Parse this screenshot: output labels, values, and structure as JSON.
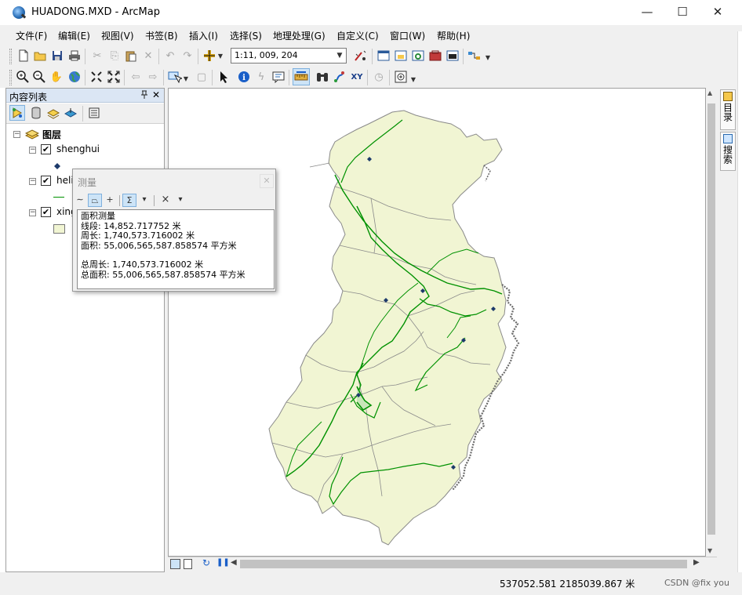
{
  "window": {
    "title": "HUADONG.MXD - ArcMap",
    "min": "—",
    "max": "☐",
    "close": "✕"
  },
  "menu": [
    "文件(F)",
    "编辑(E)",
    "视图(V)",
    "书签(B)",
    "插入(I)",
    "选择(S)",
    "地理处理(G)",
    "自定义(C)",
    "窗口(W)",
    "帮助(H)"
  ],
  "toolbar": {
    "scale": "1:11, 009, 204"
  },
  "toc": {
    "title": "内容列表",
    "pin": "𝟗",
    "close": "✕",
    "root": "图层",
    "layers": [
      {
        "name": "shenghui",
        "checked": "✔"
      },
      {
        "name": "heli",
        "checked": "✔"
      },
      {
        "name": "xing",
        "checked": "✔"
      }
    ]
  },
  "measure": {
    "title": "测量",
    "close": "✕",
    "tools": {
      "line": "∼",
      "area": "⏢",
      "feature": "+",
      "sum": "Σ",
      "units": "▾",
      "clear": "×",
      "clear_menu": "▾"
    },
    "heading": "面积测量",
    "segment": "线段: 14,852.717752 米",
    "perimeter": "周长: 1,740,573.716002 米",
    "area": "面积: 55,006,565,587.858574 平方米",
    "total_perimeter": "总周长: 1,740,573.716002 米",
    "total_area": "总面积: 55,006,565,587.858574 平方米"
  },
  "right_tabs": [
    "目录",
    "搜索"
  ],
  "status": {
    "coords": "537052.581  2185039.867 米",
    "watermark": "CSDN @fix you"
  },
  "colors": {
    "land_fill": "#f1f5d3",
    "province_border": "#8a8a8a",
    "river": "#009100",
    "capital": "#1d3a6b",
    "coast": "#6a6a6a"
  },
  "icons": {
    "app": "arcmap-globe-icon",
    "layers": "layers-icon"
  }
}
